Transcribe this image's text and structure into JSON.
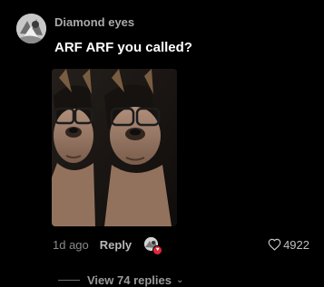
{
  "comment": {
    "username": "Diamond eyes",
    "text": "ARF ARF you called?",
    "timestamp": "1d ago",
    "reply_label": "Reply",
    "like_count": "4922",
    "view_replies_label": "View 74 replies",
    "icons": {
      "avatar": "user-avatar",
      "photo": "attached-photo",
      "reactor": "creator-liked-badge",
      "like": "heart-outline-icon",
      "expand": "chevron-down-icon"
    },
    "colors": {
      "background": "#000000",
      "username": "#a9a9a9",
      "text": "#ffffff",
      "meta": "#8a8a8a",
      "heart_badge": "#e0283d"
    }
  }
}
